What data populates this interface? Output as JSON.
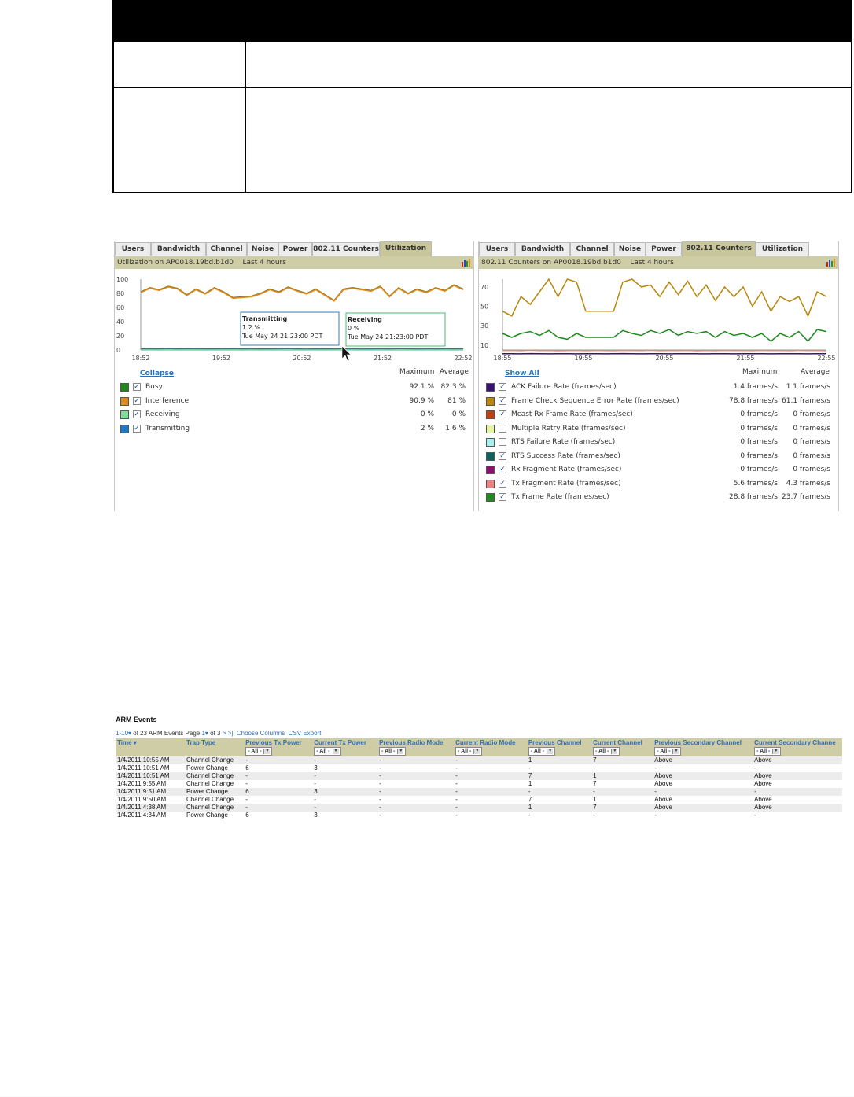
{
  "left_panel": {
    "tabs": [
      "Users",
      "Bandwidth",
      "Channel",
      "Noise",
      "Power",
      "802.11 Counters",
      "Utilization"
    ],
    "active_tab": "Utilization",
    "subheader": "Utilization on AP0018.19bd.b1d0    Last 4 hours",
    "tooltip_transmitting": {
      "title": "Transmitting",
      "value": "1.2 %",
      "time": "Tue May 24 21:23:00 PDT"
    },
    "tooltip_receiving": {
      "title": "Receiving",
      "value": "0 %",
      "time": "Tue May 24 21:23:00 PDT"
    },
    "legend_link": "Collapse",
    "col_max": "Maximum",
    "col_avg": "Average",
    "rows": [
      {
        "name": "Busy",
        "max": "92.1 %",
        "avg": "82.3 %",
        "color": "#1e8a1e",
        "checked": true
      },
      {
        "name": "Interference",
        "max": "90.9 %",
        "avg": "81 %",
        "color": "#e08a22",
        "checked": true
      },
      {
        "name": "Receiving",
        "max": "0 %",
        "avg": "0 %",
        "color": "#7fdc9a",
        "checked": true
      },
      {
        "name": "Transmitting",
        "max": "2 %",
        "avg": "1.6 %",
        "color": "#1e78c8",
        "checked": true
      }
    ]
  },
  "right_panel": {
    "tabs": [
      "Users",
      "Bandwidth",
      "Channel",
      "Noise",
      "Power",
      "802.11 Counters",
      "Utilization"
    ],
    "active_tab": "802.11 Counters",
    "subheader": "802.11 Counters on AP0018.19bd.b1d0    Last 4 hours",
    "legend_link": "Show All",
    "col_max": "Maximum",
    "col_avg": "Average",
    "rows": [
      {
        "name": "ACK Failure Rate (frames/sec)",
        "max": "1.4 frames/s",
        "avg": "1.1 frames/s",
        "color": "#3a1070",
        "checked": true
      },
      {
        "name": "Frame Check Sequence Error Rate (frames/sec)",
        "max": "78.8 frames/s",
        "avg": "61.1 frames/s",
        "color": "#b8860b",
        "checked": true
      },
      {
        "name": "Mcast Rx Frame Rate (frames/sec)",
        "max": "0 frames/s",
        "avg": "0 frames/s",
        "color": "#c04010",
        "checked": true
      },
      {
        "name": "Multiple Retry Rate (frames/sec)",
        "max": "0 frames/s",
        "avg": "0 frames/s",
        "color": "#e6f5a0",
        "checked": false
      },
      {
        "name": "RTS Failure Rate (frames/sec)",
        "max": "0 frames/s",
        "avg": "0 frames/s",
        "color": "#a8f0f0",
        "checked": false
      },
      {
        "name": "RTS Success Rate (frames/sec)",
        "max": "0 frames/s",
        "avg": "0 frames/s",
        "color": "#106060",
        "checked": true
      },
      {
        "name": "Rx Fragment Rate (frames/sec)",
        "max": "0 frames/s",
        "avg": "0 frames/s",
        "color": "#8a1070",
        "checked": true
      },
      {
        "name": "Tx Fragment Rate (frames/sec)",
        "max": "5.6 frames/s",
        "avg": "4.3 frames/s",
        "color": "#f08080",
        "checked": true
      },
      {
        "name": "Tx Frame Rate (frames/sec)",
        "max": "28.8 frames/s",
        "avg": "23.7 frames/s",
        "color": "#1e8a1e",
        "checked": true
      }
    ]
  },
  "chart_data": [
    {
      "type": "line",
      "ylim": [
        0,
        100
      ],
      "yticks": [
        0,
        20,
        40,
        60,
        80,
        100
      ],
      "xticks": [
        "18:52",
        "19:52",
        "20:52",
        "21:52",
        "22:52"
      ],
      "series": [
        {
          "name": "Busy",
          "color": "#8a7a1a",
          "values": [
            82,
            88,
            85,
            90,
            87,
            78,
            86,
            80,
            88,
            82,
            74,
            75,
            76,
            80,
            86,
            82,
            89,
            84,
            80,
            86,
            78,
            70,
            86,
            88,
            86,
            84,
            90,
            76,
            88,
            80,
            86,
            82,
            88,
            84,
            92,
            86
          ]
        },
        {
          "name": "Interference",
          "color": "#e08a22",
          "values": [
            81,
            87,
            84,
            89,
            86,
            77,
            85,
            79,
            87,
            81,
            73,
            74,
            75,
            79,
            85,
            81,
            88,
            83,
            79,
            85,
            77,
            69,
            85,
            87,
            85,
            83,
            89,
            75,
            87,
            79,
            85,
            81,
            87,
            83,
            91,
            85
          ]
        },
        {
          "name": "Transmitting",
          "color": "#1e78c8",
          "values": [
            1.5,
            1.6,
            1.4,
            1.8,
            1.5,
            1.7,
            1.6,
            1.5,
            1.4,
            1.6,
            1.7,
            1.5,
            1.6,
            1.4,
            1.5,
            1.6,
            1.8,
            1.5,
            1.2,
            1.6,
            1.4,
            1.5,
            1.7,
            1.6,
            1.5,
            1.4,
            1.6,
            1.5,
            1.7,
            1.6,
            1.5,
            1.6,
            1.4,
            1.6,
            1.5,
            1.6
          ]
        },
        {
          "name": "Receiving",
          "color": "#7fdc9a",
          "values": [
            0,
            0,
            0,
            0,
            0,
            0,
            0,
            0,
            0,
            0,
            0,
            0,
            0,
            0,
            0,
            0,
            0,
            0,
            0,
            0,
            0,
            0,
            0,
            0,
            0,
            0,
            0,
            0,
            0,
            0,
            0,
            0,
            0,
            0,
            0,
            0
          ]
        }
      ]
    },
    {
      "type": "line",
      "ylim": [
        5,
        78
      ],
      "yticks": [
        10,
        30,
        50,
        70
      ],
      "xticks": [
        "18:55",
        "19:55",
        "20:55",
        "21:55",
        "22:55"
      ],
      "series": [
        {
          "name": "Frame Check Sequence Error Rate (frames/sec)",
          "color": "#b8860b",
          "values": [
            45,
            40,
            60,
            52,
            65,
            78,
            60,
            78,
            75,
            45,
            45,
            45,
            45,
            75,
            78,
            70,
            72,
            60,
            75,
            62,
            76,
            60,
            72,
            56,
            70,
            60,
            70,
            50,
            65,
            45,
            60,
            55,
            60,
            40,
            65,
            60
          ]
        },
        {
          "name": "Tx Frame Rate (frames/sec)",
          "color": "#1e8a1e",
          "values": [
            22,
            18,
            22,
            24,
            20,
            25,
            18,
            16,
            22,
            18,
            18,
            18,
            18,
            25,
            22,
            20,
            25,
            22,
            26,
            20,
            24,
            22,
            24,
            18,
            24,
            20,
            22,
            18,
            22,
            14,
            22,
            18,
            24,
            14,
            26,
            24
          ]
        },
        {
          "name": "Tx Fragment Rate (frames/sec)",
          "color": "#f08080",
          "values": [
            4.5,
            4.6,
            4.3,
            4.8,
            4.4,
            4.5,
            4.2,
            4.4,
            4.6,
            4.3,
            4.5,
            4.4,
            4.3,
            4.6,
            4.5,
            4.4,
            4.7,
            4.3,
            4.5,
            4.4,
            4.6,
            4.2,
            4.5,
            4.3,
            4.6,
            4.4,
            4.5,
            4.3,
            4.6,
            4.4,
            4.5,
            4.3,
            4.6,
            4.4,
            4.5,
            4.3
          ]
        },
        {
          "name": "ACK Failure Rate (frames/sec)",
          "color": "#3a1070",
          "values": [
            1.1,
            1.2,
            1.0,
            1.3,
            1.1,
            1.0,
            1.2,
            1.1,
            1.0,
            1.1,
            1.2,
            1.0,
            1.1,
            1.3,
            1.1,
            1.0,
            1.2,
            1.1,
            1.0,
            1.1,
            1.2,
            1.1,
            1.0,
            1.2,
            1.1,
            1.0,
            1.1,
            1.2,
            1.1,
            1.0,
            1.1,
            1.2,
            1.1,
            1.0,
            1.1,
            1.2
          ]
        }
      ]
    }
  ],
  "arm": {
    "title": "ARM Events",
    "pager_range": "1-10",
    "pager_of": "of 23 ARM Events",
    "pager_page": "Page",
    "pager_num": "1",
    "pager_total": "of 3",
    "pager_next": ">",
    "pager_last": ">|",
    "choose_columns": "Choose Columns",
    "csv_export": "CSV Export",
    "filter_label": "- All -",
    "columns": [
      "Time",
      "Trap Type",
      "Previous Tx Power",
      "Current Tx Power",
      "Previous Radio Mode",
      "Current Radio Mode",
      "Previous Channel",
      "Current Channel",
      "Previous Secondary Channel",
      "Current Secondary Channe"
    ],
    "rows": [
      [
        "1/4/2011 10:55 AM",
        "Channel Change",
        "-",
        "-",
        "-",
        "-",
        "1",
        "7",
        "Above",
        "Above"
      ],
      [
        "1/4/2011 10:51 AM",
        "Power Change",
        "6",
        "3",
        "-",
        "-",
        "-",
        "-",
        "-",
        "-"
      ],
      [
        "1/4/2011 10:51 AM",
        "Channel Change",
        "-",
        "-",
        "-",
        "-",
        "7",
        "1",
        "Above",
        "Above"
      ],
      [
        "1/4/2011 9:55 AM",
        "Channel Change",
        "-",
        "-",
        "-",
        "-",
        "1",
        "7",
        "Above",
        "Above"
      ],
      [
        "1/4/2011 9:51 AM",
        "Power Change",
        "6",
        "3",
        "-",
        "-",
        "-",
        "-",
        "-",
        "-"
      ],
      [
        "1/4/2011 9:50 AM",
        "Channel Change",
        "-",
        "-",
        "-",
        "-",
        "7",
        "1",
        "Above",
        "Above"
      ],
      [
        "1/4/2011 4:38 AM",
        "Channel Change",
        "-",
        "-",
        "-",
        "-",
        "1",
        "7",
        "Above",
        "Above"
      ],
      [
        "1/4/2011 4:34 AM",
        "Power Change",
        "6",
        "3",
        "-",
        "-",
        "-",
        "-",
        "-",
        "-"
      ]
    ]
  }
}
